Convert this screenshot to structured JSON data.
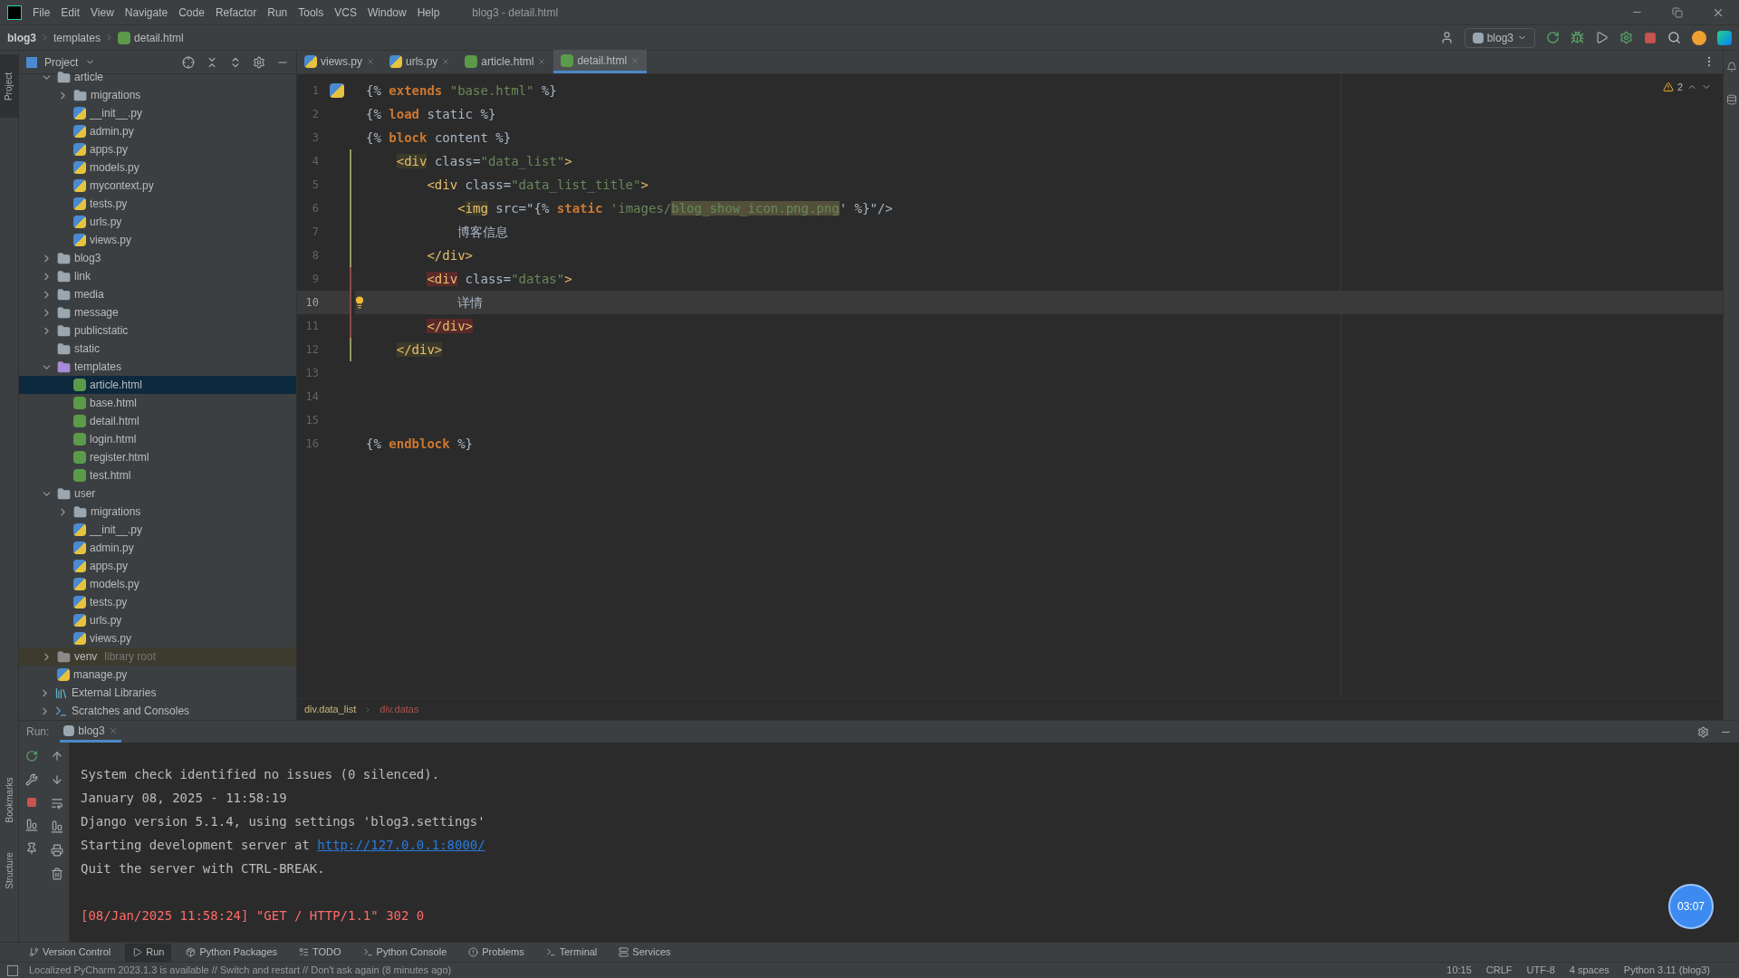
{
  "window": {
    "title": "blog3 - detail.html",
    "menu": [
      "File",
      "Edit",
      "View",
      "Navigate",
      "Code",
      "Refactor",
      "Run",
      "Tools",
      "VCS",
      "Window",
      "Help"
    ]
  },
  "navbar": {
    "crumbs": [
      {
        "label": "blog3",
        "kind": "project"
      },
      {
        "label": "templates",
        "kind": "folder"
      },
      {
        "label": "detail.html",
        "kind": "html"
      }
    ],
    "run_config": "blog3"
  },
  "left_stripe": [
    "Project",
    "Bookmarks",
    "Structure"
  ],
  "project": {
    "title": "Project",
    "tree": [
      {
        "label": "article",
        "kind": "folder",
        "expanded": true,
        "selected": false,
        "children": [
          {
            "label": "migrations",
            "kind": "folder",
            "expanded": false,
            "selected": false
          },
          {
            "label": "__init__.py",
            "kind": "python",
            "selected": false
          },
          {
            "label": "admin.py",
            "kind": "python",
            "selected": false
          },
          {
            "label": "apps.py",
            "kind": "python",
            "selected": false
          },
          {
            "label": "models.py",
            "kind": "python",
            "selected": false
          },
          {
            "label": "mycontext.py",
            "kind": "python",
            "selected": false
          },
          {
            "label": "tests.py",
            "kind": "python",
            "selected": false
          },
          {
            "label": "urls.py",
            "kind": "python",
            "selected": false
          },
          {
            "label": "views.py",
            "kind": "python",
            "selected": false
          }
        ]
      },
      {
        "label": "blog3",
        "kind": "folder",
        "expanded": false,
        "selected": false
      },
      {
        "label": "link",
        "kind": "folder",
        "expanded": false,
        "selected": false
      },
      {
        "label": "media",
        "kind": "folder",
        "expanded": false,
        "selected": false
      },
      {
        "label": "message",
        "kind": "folder",
        "expanded": false,
        "selected": false
      },
      {
        "label": "publicstatic",
        "kind": "folder",
        "expanded": false,
        "selected": false
      },
      {
        "label": "static",
        "kind": "folder",
        "selected": false
      },
      {
        "label": "templates",
        "kind": "templates",
        "expanded": true,
        "selected": false,
        "children": [
          {
            "label": "article.html",
            "kind": "html",
            "selected": true
          },
          {
            "label": "base.html",
            "kind": "html",
            "selected": false
          },
          {
            "label": "detail.html",
            "kind": "html",
            "selected": false
          },
          {
            "label": "login.html",
            "kind": "html",
            "selected": false
          },
          {
            "label": "register.html",
            "kind": "html",
            "selected": false
          },
          {
            "label": "test.html",
            "kind": "html",
            "selected": false
          }
        ]
      },
      {
        "label": "user",
        "kind": "folder",
        "expanded": true,
        "selected": false,
        "children": [
          {
            "label": "migrations",
            "kind": "folder",
            "expanded": false,
            "selected": false
          },
          {
            "label": "__init__.py",
            "kind": "python",
            "selected": false
          },
          {
            "label": "admin.py",
            "kind": "python",
            "selected": false
          },
          {
            "label": "apps.py",
            "kind": "python",
            "selected": false
          },
          {
            "label": "models.py",
            "kind": "python",
            "selected": false
          },
          {
            "label": "tests.py",
            "kind": "python",
            "selected": false
          },
          {
            "label": "urls.py",
            "kind": "python",
            "selected": false
          },
          {
            "label": "views.py",
            "kind": "python",
            "selected": false
          }
        ]
      },
      {
        "label": "venv",
        "note": "library root",
        "kind": "excluded",
        "expanded": false,
        "selected": false
      },
      {
        "label": "manage.py",
        "kind": "python",
        "selected": false
      }
    ],
    "roots": [
      {
        "label": "External Libraries",
        "kind": "library"
      },
      {
        "label": "Scratches and Consoles",
        "kind": "scratches"
      }
    ]
  },
  "editor": {
    "tabs": [
      {
        "label": "views.py",
        "kind": "python",
        "selected": false
      },
      {
        "label": "urls.py",
        "kind": "python",
        "selected": false
      },
      {
        "label": "article.html",
        "kind": "html",
        "selected": false
      },
      {
        "label": "detail.html",
        "kind": "html",
        "selected": true
      }
    ],
    "warnings": "2",
    "lines": [
      {
        "number": "1",
        "current": false,
        "kind": "python_icon",
        "tokens": [
          {
            "t": "{%",
            "kind": "plain"
          },
          {
            "t": " extends",
            "kind": "kw"
          },
          {
            "t": " \"base.html\"",
            "kind": "str"
          },
          {
            "t": " %}",
            "kind": "plain"
          }
        ]
      },
      {
        "number": "2",
        "current": false,
        "kind": "plain",
        "tokens": [
          {
            "t": "{%",
            "kind": "plain"
          },
          {
            "t": " load",
            "kind": "kw"
          },
          {
            "t": " static %}",
            "kind": "plain"
          }
        ]
      },
      {
        "number": "3",
        "current": false,
        "kind": "plain",
        "tokens": [
          {
            "t": "{%",
            "kind": "plain"
          },
          {
            "t": " block",
            "kind": "kw"
          },
          {
            "t": " content %}",
            "kind": "plain"
          }
        ]
      },
      {
        "number": "4",
        "current": false,
        "kind": "plain",
        "tokens": [
          {
            "t": "    <div",
            "kind": "tag_match"
          },
          {
            "t": " class=",
            "kind": "plain"
          },
          {
            "t": "\"data_list\"",
            "kind": "str"
          },
          {
            "t": ">",
            "kind": "tag"
          }
        ]
      },
      {
        "number": "5",
        "current": false,
        "kind": "plain",
        "tokens": [
          {
            "t": "        <div",
            "kind": "tag"
          },
          {
            "t": " class=",
            "kind": "plain"
          },
          {
            "t": "\"data_list_title\"",
            "kind": "str"
          },
          {
            "t": ">",
            "kind": "tag"
          }
        ]
      },
      {
        "number": "6",
        "current": false,
        "kind": "plain",
        "tokens": [
          {
            "t": "            <",
            "kind": "tag"
          },
          {
            "t": "img",
            "kind": "tag_match"
          },
          {
            "t": " src=\"{%",
            "kind": "plain"
          },
          {
            "t": " static",
            "kind": "kw"
          },
          {
            "t": " 'images/",
            "kind": "str"
          },
          {
            "t": "blog_show_icon.png.png",
            "kind": "str_hl"
          },
          {
            "t": "' %}\"/>",
            "kind": "plain"
          }
        ]
      },
      {
        "number": "7",
        "current": false,
        "kind": "plain",
        "tokens": [
          {
            "t": "            博客信息",
            "kind": "plain"
          }
        ]
      },
      {
        "number": "8",
        "current": false,
        "kind": "plain",
        "tokens": [
          {
            "t": "        </div>",
            "kind": "tag"
          }
        ]
      },
      {
        "number": "9",
        "current": false,
        "kind": "plain",
        "tokens": [
          {
            "t": "        <div",
            "kind": "tag_error"
          },
          {
            "t": " class=",
            "kind": "plain"
          },
          {
            "t": "\"datas\"",
            "kind": "str"
          },
          {
            "t": ">",
            "kind": "tag"
          }
        ]
      },
      {
        "number": "10",
        "current": true,
        "kind": "bulb",
        "tokens": [
          {
            "t": "            详情",
            "kind": "plain"
          }
        ]
      },
      {
        "number": "11",
        "current": false,
        "kind": "plain",
        "tokens": [
          {
            "t": "        </div>",
            "kind": "tag_error"
          }
        ]
      },
      {
        "number": "12",
        "current": false,
        "kind": "plain",
        "tokens": [
          {
            "t": "    </div>",
            "kind": "tag_match"
          }
        ]
      },
      {
        "number": "13",
        "current": false,
        "kind": "plain"
      },
      {
        "number": "14",
        "current": false,
        "kind": "plain"
      },
      {
        "number": "15",
        "current": false,
        "kind": "plain"
      },
      {
        "number": "16",
        "current": false,
        "kind": "plain",
        "tokens": [
          {
            "t": "{%",
            "kind": "plain"
          },
          {
            "t": " endblock",
            "kind": "kw"
          },
          {
            "t": " %}",
            "kind": "plain"
          }
        ]
      }
    ],
    "breadcrumbs": [
      {
        "label": "div.data_list",
        "selected": false
      },
      {
        "label": "div.datas",
        "selected": true
      }
    ]
  },
  "run": {
    "label": "Run:",
    "tab": "blog3",
    "console": [
      {
        "kind": "info",
        "text": "System check identified no issues (0 silenced)."
      },
      {
        "kind": "info",
        "text": "January 08, 2025 - 11:58:19"
      },
      {
        "kind": "info",
        "text": "Django version 5.1.4, using settings 'blog3.settings'"
      },
      {
        "kind": "info",
        "text": "Starting development server at ",
        "link": "http://127.0.0.1:8000/"
      },
      {
        "kind": "info",
        "text": "Quit the server with CTRL-BREAK."
      },
      {
        "kind": "blank"
      },
      {
        "kind": "error",
        "text": "[08/Jan/2025 11:58:24] \"GET / HTTP/1.1\" 302 0"
      }
    ]
  },
  "recording_timer": "03:07",
  "tool_tabs": [
    {
      "label": "Version Control",
      "selected": false
    },
    {
      "label": "Run",
      "selected": true
    },
    {
      "label": "Python Packages",
      "selected": false
    },
    {
      "label": "TODO",
      "selected": false
    },
    {
      "label": "Python Console",
      "selected": false
    },
    {
      "label": "Problems",
      "selected": false
    },
    {
      "label": "Terminal",
      "selected": false
    },
    {
      "label": "Services",
      "selected": false
    }
  ],
  "status_bar": {
    "message": "Localized PyCharm 2023.1.3 is available // Switch and restart // Don't ask again (8 minutes ago)",
    "items": [
      "10:15",
      "CRLF",
      "UTF-8",
      "4 spaces",
      "Python 3.11 (blog3)"
    ]
  }
}
